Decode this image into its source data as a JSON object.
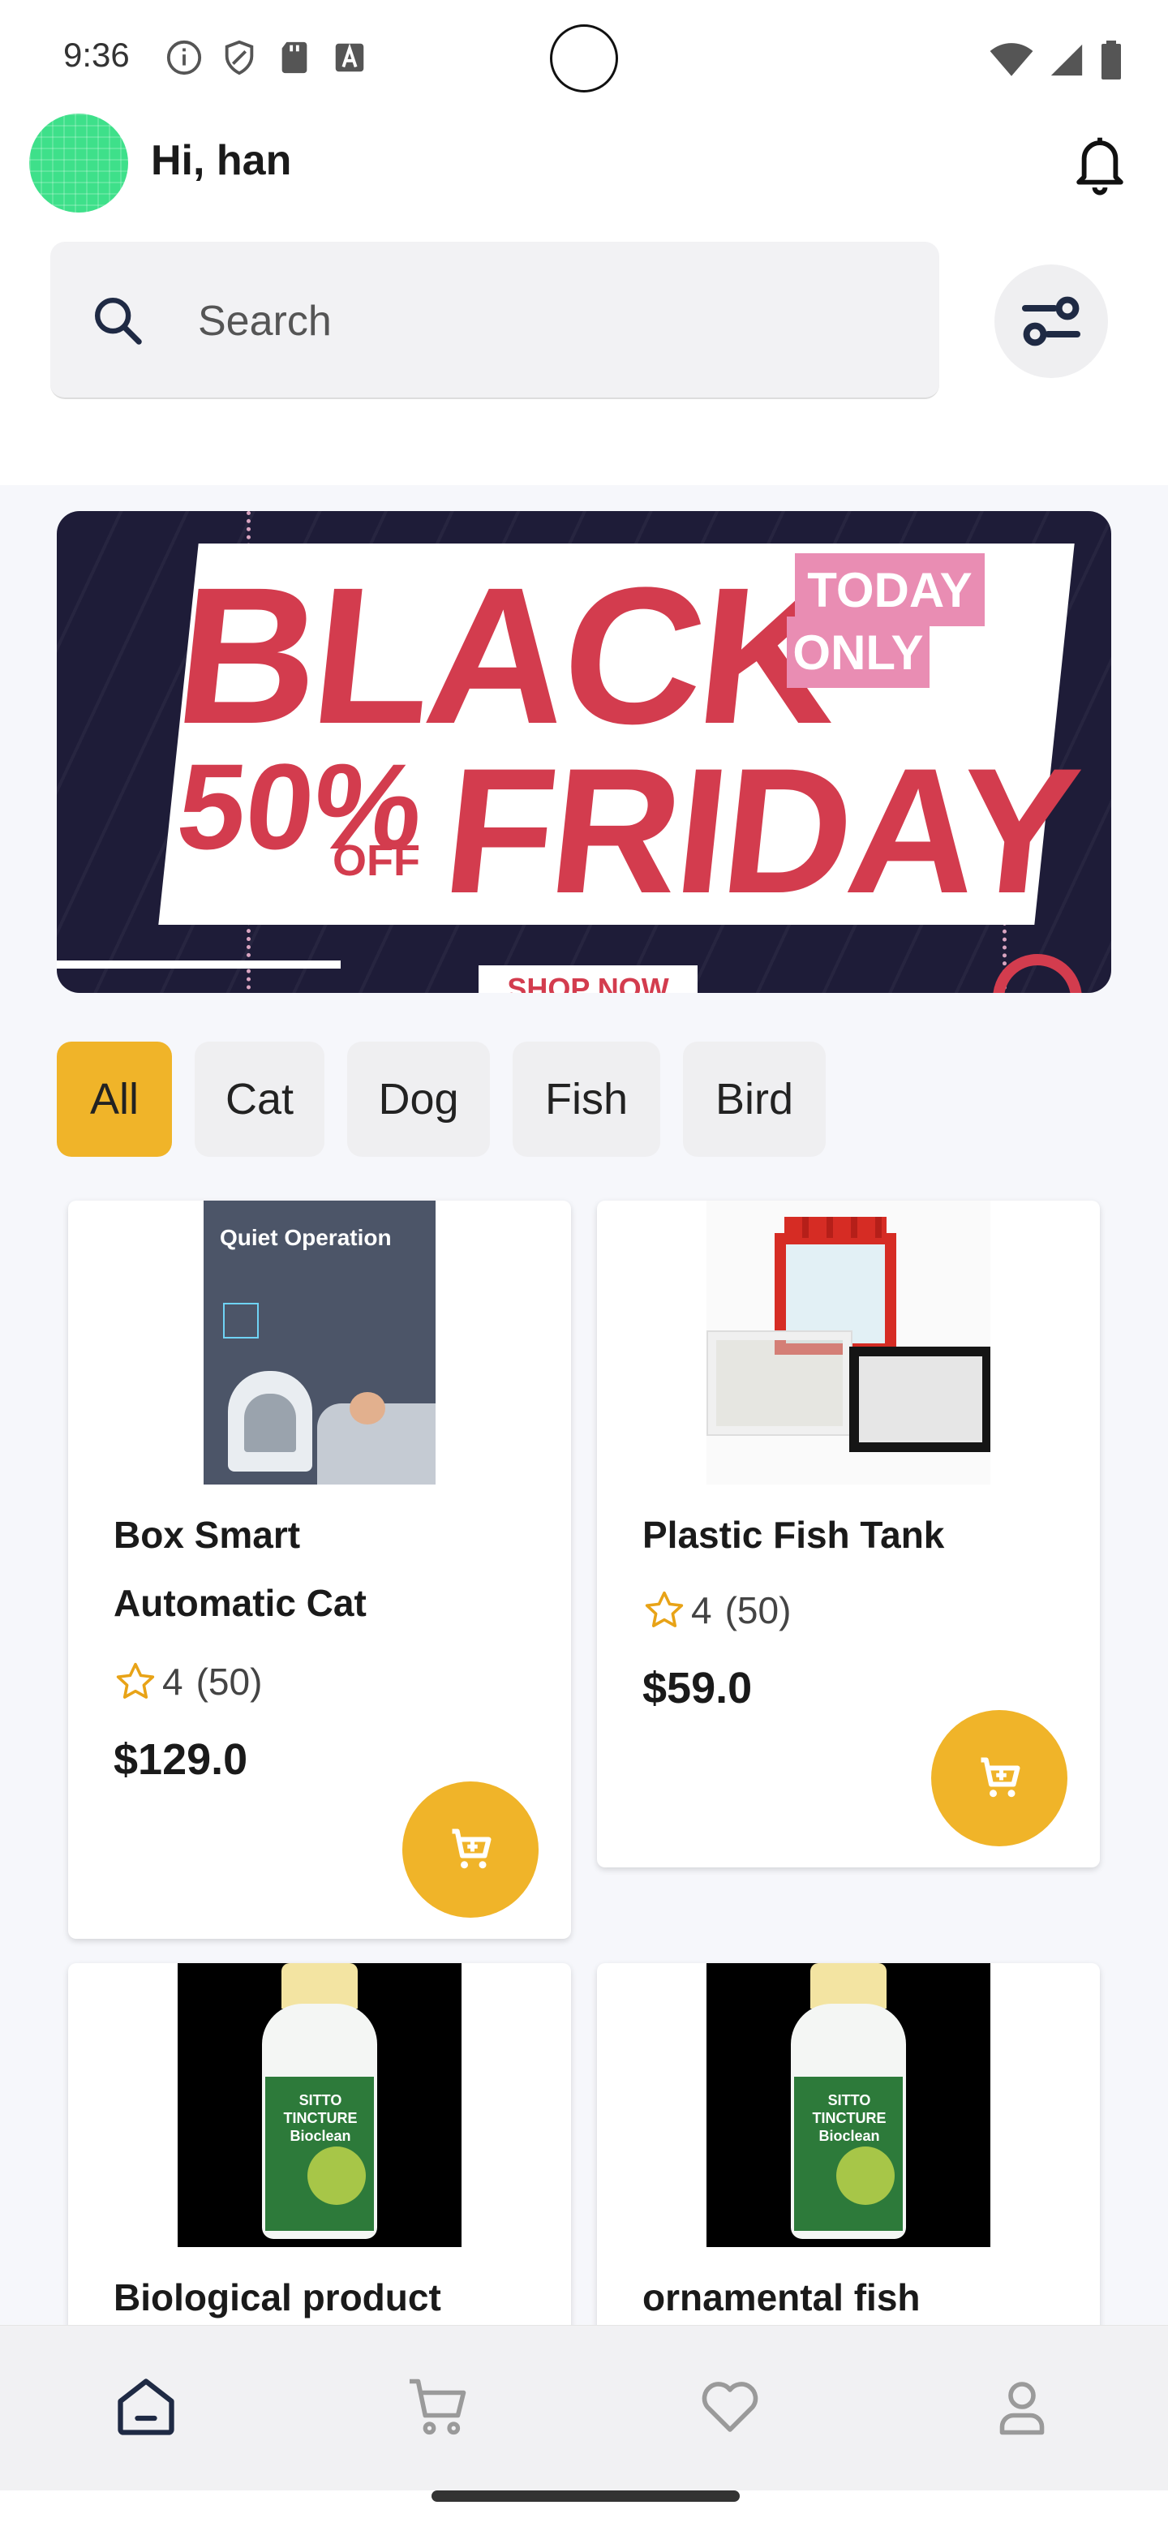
{
  "status_bar": {
    "time": "9:36"
  },
  "header": {
    "greeting": "Hi, han"
  },
  "search": {
    "placeholder": "Search"
  },
  "banner": {
    "title_top": "BLACK",
    "title_bottom": "FRIDAY",
    "discount": "50%",
    "discount_suffix": "OFF",
    "badge_line1": "TODAY",
    "badge_line2": "ONLY",
    "cta": "SHOP NOW",
    "colors": {
      "background": "#1e1c38",
      "accent": "#d33c4e",
      "badge": "#e98db3"
    }
  },
  "categories": [
    {
      "label": "All",
      "active": true
    },
    {
      "label": "Cat",
      "active": false
    },
    {
      "label": "Dog",
      "active": false
    },
    {
      "label": "Fish",
      "active": false
    },
    {
      "label": "Bird",
      "active": false
    }
  ],
  "products": [
    {
      "title_line1": " Box Smart",
      "title_line2": "Automatic Cat",
      "rating": "4",
      "reviews": "(50)",
      "price": "$129.0",
      "image_caption": "Quiet Operation"
    },
    {
      "title_line1": "Plastic Fish Tank",
      "rating": "4",
      "reviews": "(50)",
      "price": "$59.0"
    },
    {
      "title_line1": "Biological product",
      "image_label": "SITTO TINCTURE Bioclean"
    },
    {
      "title_line1": "ornamental fish",
      "image_label": "SITTO TINCTURE Bioclean"
    }
  ],
  "bottom_nav": [
    {
      "icon": "home-icon",
      "active": true
    },
    {
      "icon": "cart-icon",
      "active": false
    },
    {
      "icon": "heart-icon",
      "active": false
    },
    {
      "icon": "profile-icon",
      "active": false
    }
  ],
  "theme": {
    "accent": "#f0b429",
    "avatar": "#3ee08a"
  }
}
